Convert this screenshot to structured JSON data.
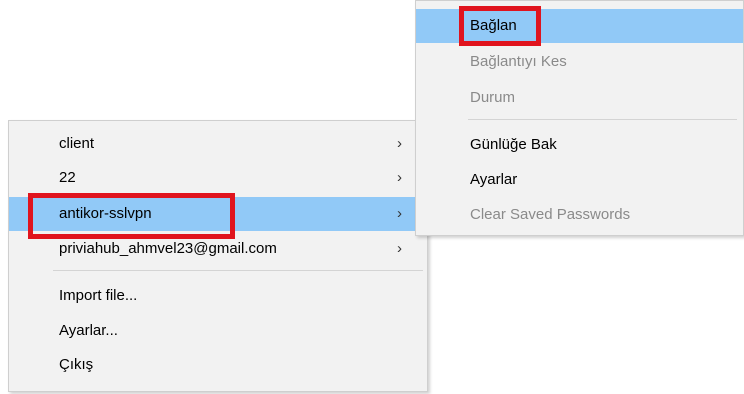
{
  "main_menu": {
    "items": [
      {
        "label": "client",
        "chevron": "›"
      },
      {
        "label": "22",
        "chevron": "›"
      },
      {
        "label": "antikor-sslvpn",
        "chevron": "›"
      },
      {
        "label": "priviahub_ahmvel23@gmail.com",
        "chevron": "›"
      },
      {
        "label": "Import file..."
      },
      {
        "label": "Ayarlar..."
      },
      {
        "label": "Çıkış"
      }
    ]
  },
  "sub_menu": {
    "items": [
      {
        "label": "Bağlan"
      },
      {
        "label": "Bağlantıyı Kes"
      },
      {
        "label": "Durum"
      },
      {
        "label": "Günlüğe Bak"
      },
      {
        "label": "Ayarlar"
      },
      {
        "label": "Clear Saved Passwords"
      }
    ]
  },
  "colors": {
    "selection": "#91c9f7",
    "highlight_box": "#e0141e",
    "disabled_text": "#8a8a8a",
    "menu_background": "#f2f2f2"
  },
  "icons": {
    "submenu_arrow": "chevron-right-icon"
  }
}
